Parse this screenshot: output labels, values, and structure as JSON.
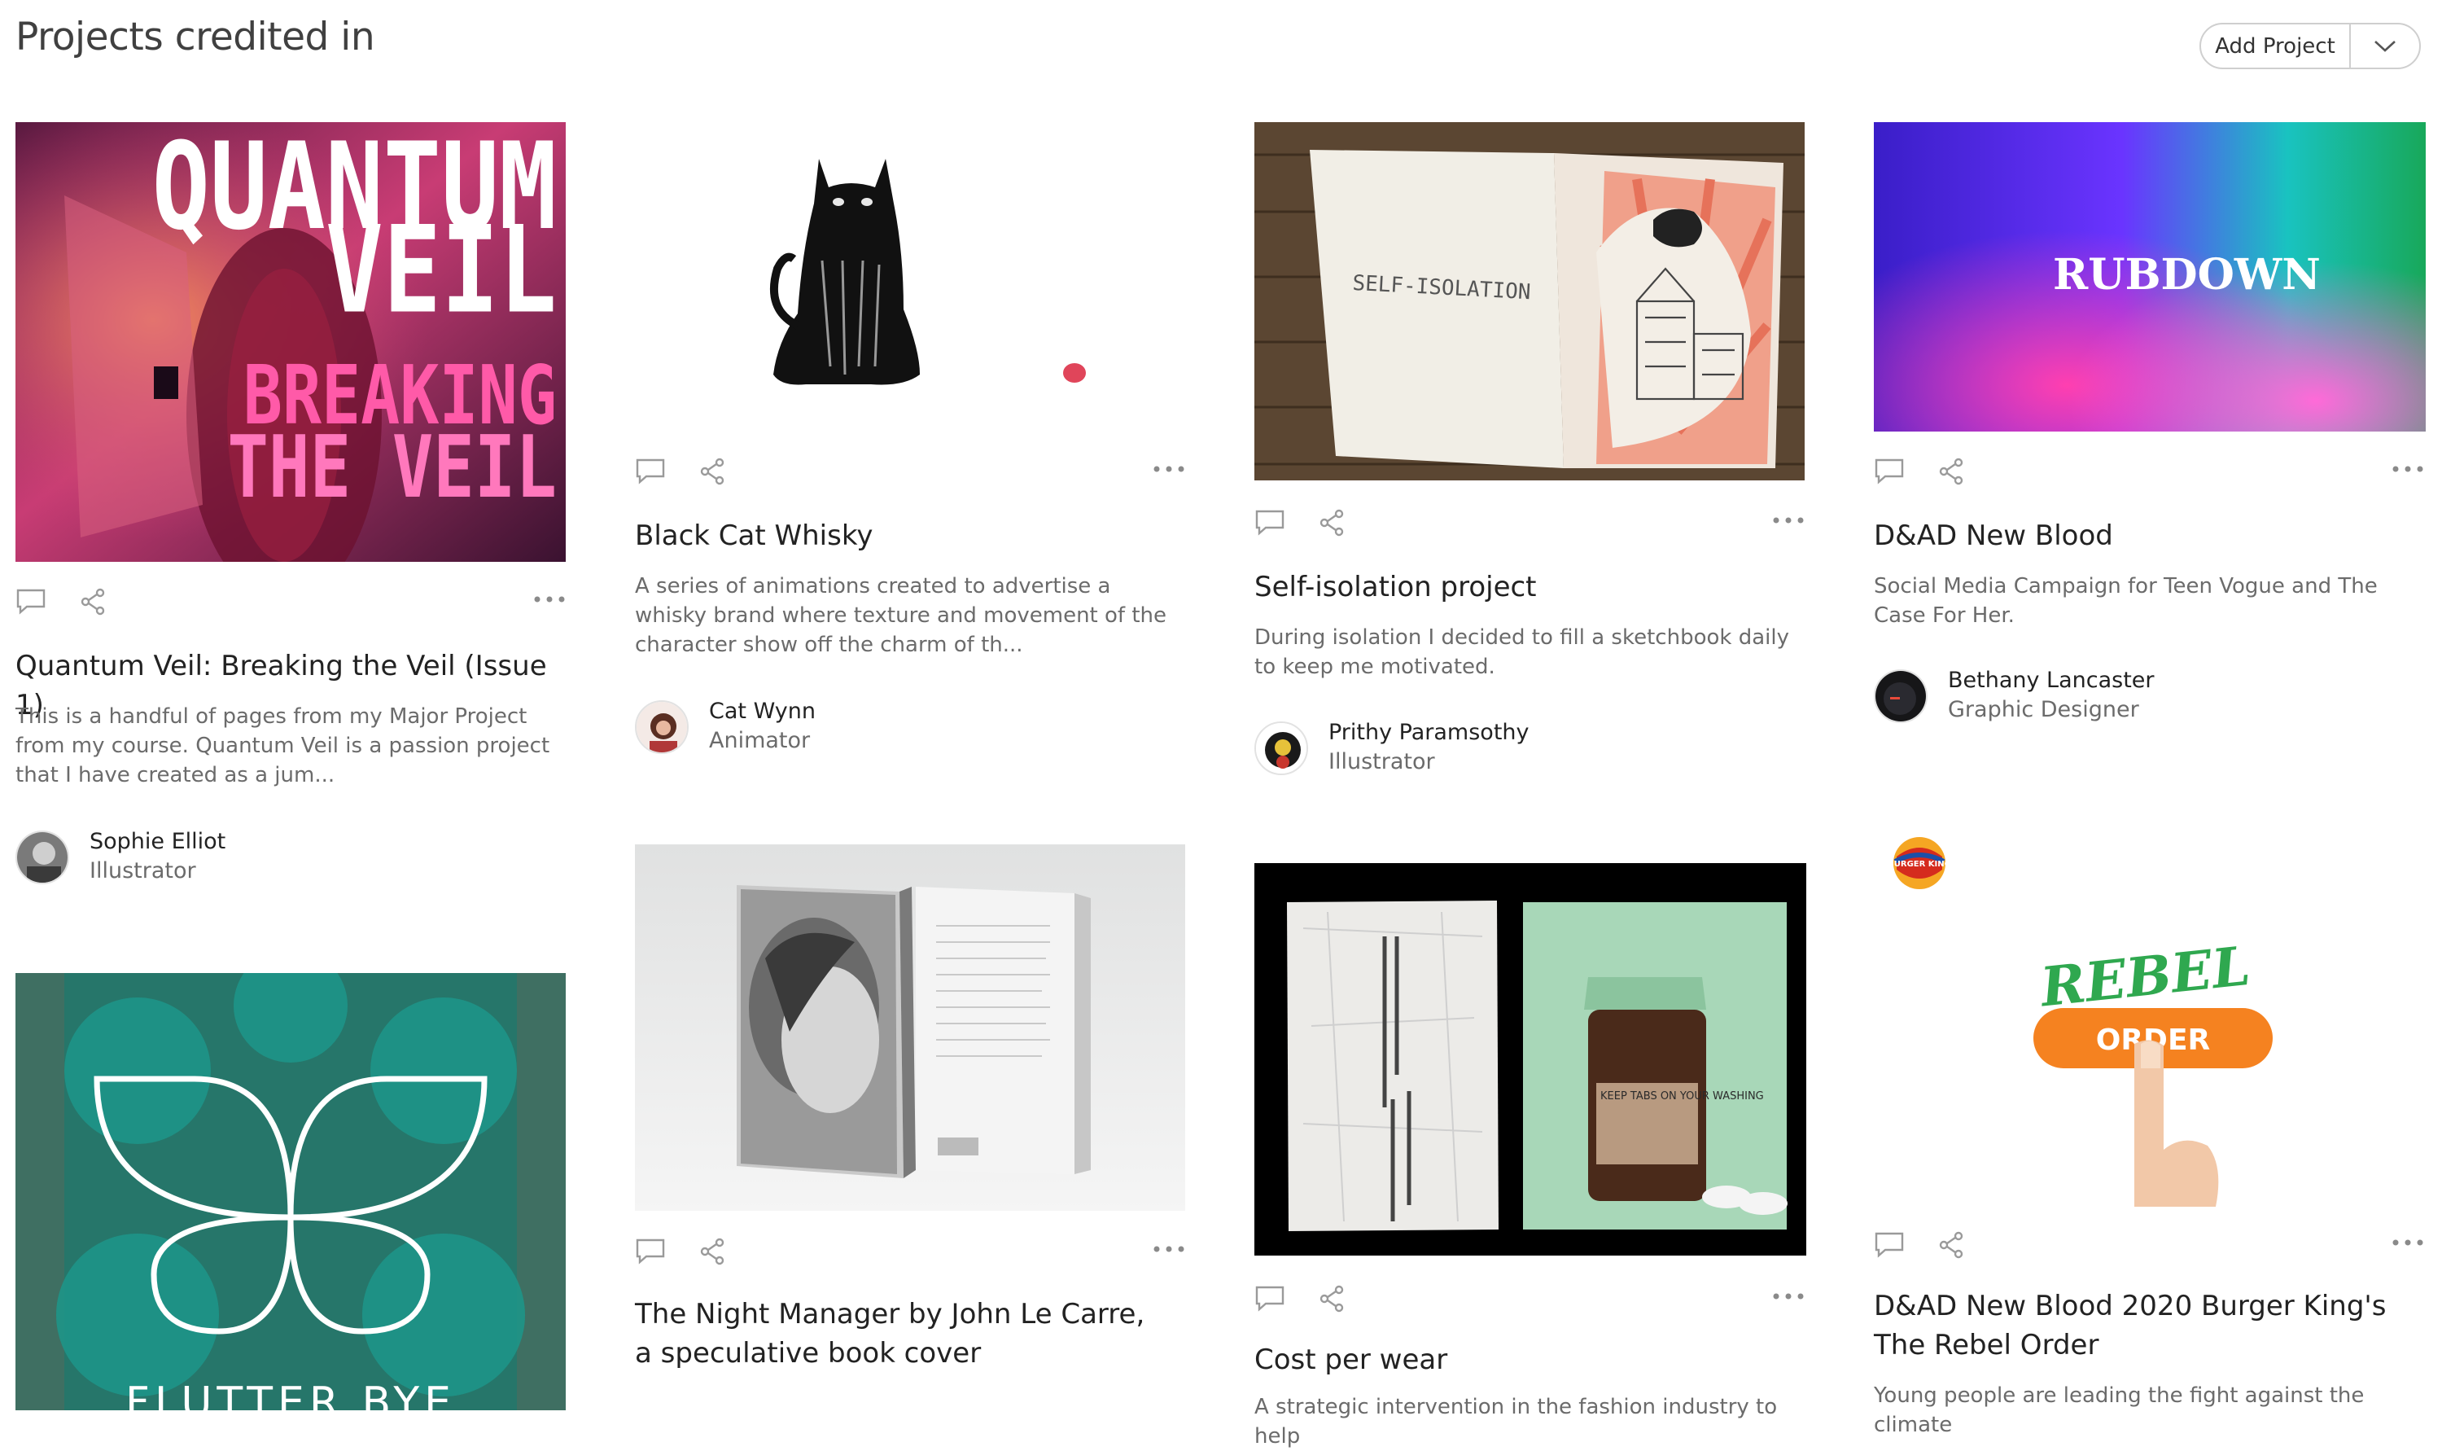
{
  "header": {
    "title": "Projects credited in",
    "add_project_label": "Add Project"
  },
  "cards": [
    {
      "title": "Quantum Veil: Breaking the Veil (Issue 1)",
      "description": "This is a handful of pages from my Major Project from my course. Quantum Veil is a passion project that I have created as a jum...",
      "author": "Sophie Elliot",
      "role": "Illustrator",
      "cover_text": [
        "QUANTUM",
        "VEIL",
        "BREAKING",
        "THE VEIL"
      ]
    },
    {
      "title": "Black Cat Whisky",
      "description": "A series of animations created to advertise a whisky brand where texture and movement of the character show off the charm of th...",
      "author": "Cat Wynn",
      "role": "Animator"
    },
    {
      "title": "Self-isolation project",
      "description": "During isolation I decided to fill a sketchbook daily to keep me motivated.",
      "author": "Prithy Paramsothy",
      "role": "Illustrator",
      "cover_text": "SELF-ISOLATION"
    },
    {
      "title": "D&AD New Blood",
      "description": "Social Media Campaign for Teen Vogue and The Case For Her.",
      "author": "Bethany Lancaster",
      "role": "Graphic Designer",
      "cover_text": "RUBDOWN"
    },
    {
      "title": "",
      "cover_text": "FLUTTER BYE"
    },
    {
      "title": "The Night Manager by John Le Carre, a speculative book cover"
    },
    {
      "title": "Cost per wear",
      "description": "A strategic intervention in the fashion industry to help",
      "cover_text": "KEEP TABS ON YOUR WASHING"
    },
    {
      "title": "D&AD New Blood 2020 Burger King's The Rebel Order",
      "description": "Young people are leading the fight against the climate",
      "cover_text": [
        "REBEL",
        "ORDER"
      ],
      "logo_text": "BURGER KING"
    }
  ]
}
